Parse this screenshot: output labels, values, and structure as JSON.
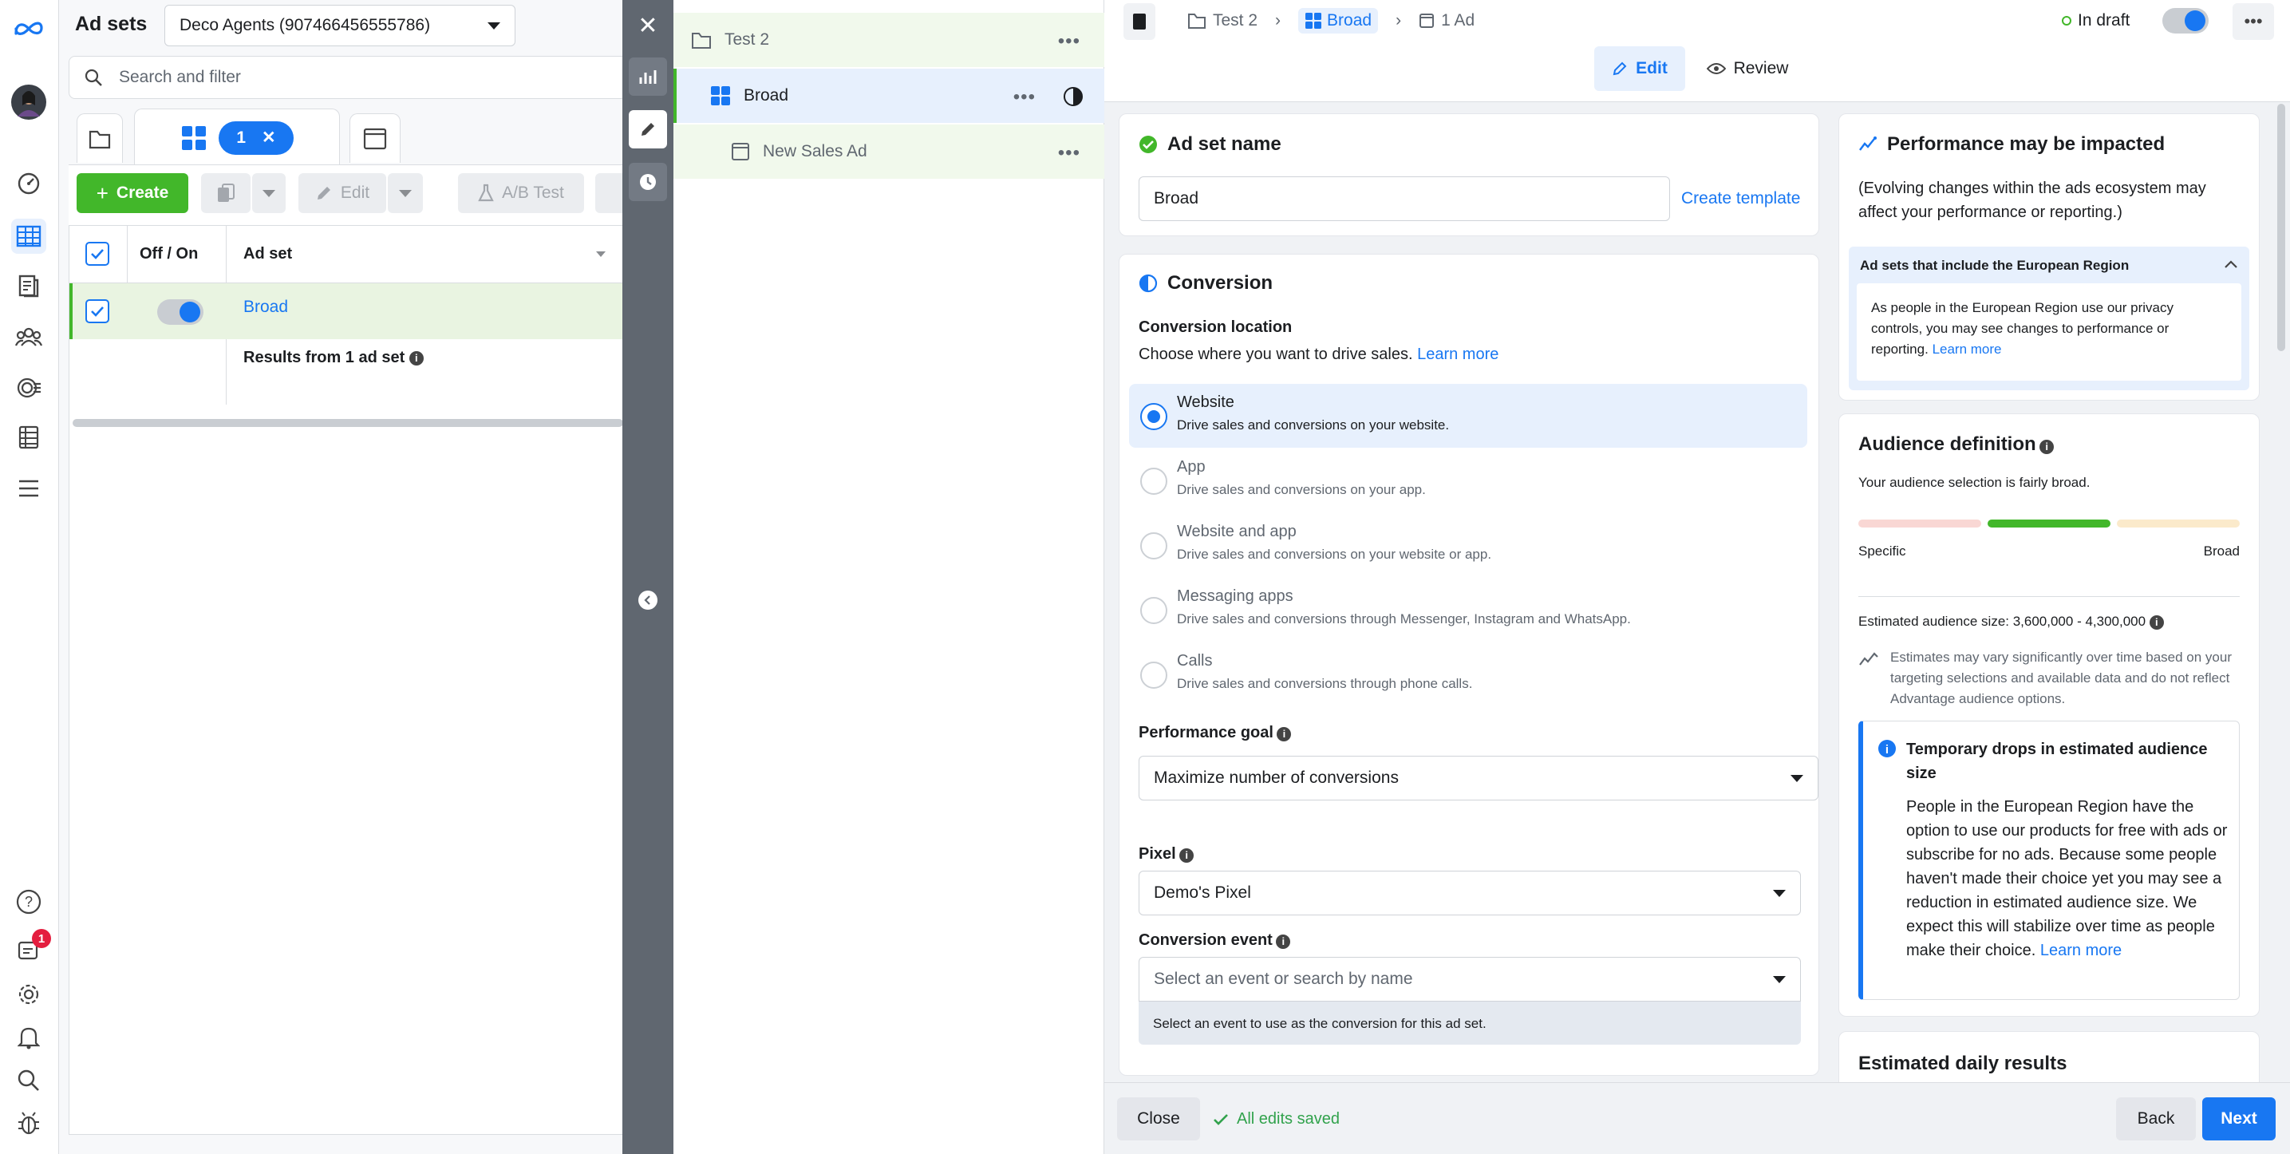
{
  "left_panel": {
    "title": "Ad sets",
    "account": "Deco Agents (907466456555786)",
    "search_placeholder": "Search and filter",
    "selection_count": "1",
    "toolbar": {
      "create": "Create",
      "edit": "Edit",
      "ab_test": "A/B Test"
    },
    "table": {
      "col_toggle": "Off / On",
      "col_adset": "Ad set",
      "rows": [
        {
          "name": "Broad"
        }
      ],
      "results": "Results from 1 ad set"
    }
  },
  "notifications_badge": "1",
  "tree": {
    "campaign": "Test 2",
    "adset": "Broad",
    "ad": "New Sales Ad"
  },
  "breadcrumb": {
    "campaign": "Test 2",
    "adset": "Broad",
    "ad": "1 Ad"
  },
  "status": "In draft",
  "view_tabs": {
    "edit": "Edit",
    "review": "Review"
  },
  "adset_name_card": {
    "title": "Ad set name",
    "value": "Broad",
    "create_template": "Create template"
  },
  "conversion_card": {
    "title": "Conversion",
    "location_label": "Conversion location",
    "location_help": "Choose where you want to drive sales.",
    "learn_more": "Learn more",
    "options": [
      {
        "title": "Website",
        "desc": "Drive sales and conversions on your website.",
        "selected": true
      },
      {
        "title": "App",
        "desc": "Drive sales and conversions on your app.",
        "selected": false
      },
      {
        "title": "Website and app",
        "desc": "Drive sales and conversions on your website or app.",
        "selected": false
      },
      {
        "title": "Messaging apps",
        "desc": "Drive sales and conversions through Messenger, Instagram and WhatsApp.",
        "selected": false
      },
      {
        "title": "Calls",
        "desc": "Drive sales and conversions through phone calls.",
        "selected": false
      }
    ],
    "performance_goal_label": "Performance goal",
    "performance_goal_value": "Maximize number of conversions",
    "pixel_label": "Pixel",
    "pixel_value": "Demo's Pixel",
    "conversion_event_label": "Conversion event",
    "conversion_event_placeholder": "Select an event or search by name",
    "conversion_event_hint": "Select an event to use as the conversion for this ad set."
  },
  "performance_card": {
    "title": "Performance may be impacted",
    "body": "(Evolving changes within the ads ecosystem may affect your performance or reporting.)",
    "section_title": "Ad sets that include the European Region",
    "section_body": "As people in the European Region use our privacy controls, you may see changes to performance or reporting.",
    "learn_more": "Learn more"
  },
  "audience_card": {
    "title": "Audience definition",
    "summary": "Your audience selection is fairly broad.",
    "left_label": "Specific",
    "right_label": "Broad",
    "estimated_size": "Estimated audience size: 3,600,000 - 4,300,000",
    "estimate_note": "Estimates may vary significantly over time based on your targeting selections and available data and do not reflect Advantage audience options.",
    "notice_title": "Temporary drops in estimated audience size",
    "notice_body": "People in the European Region have the option to use our products for free with ads or subscribe for no ads. Because some people haven't made their choice yet you may see a reduction in estimated audience size. We expect this will stabilize over time as people make their choice.",
    "notice_link": "Learn more"
  },
  "daily_results_title": "Estimated daily results",
  "footer": {
    "close": "Close",
    "saved": "All edits saved",
    "back": "Back",
    "next": "Next"
  },
  "colors": {
    "accent": "#1877f2",
    "create_green": "#42b72a",
    "selected_row": "#e9f4e1",
    "gauge_active": "#42b72a"
  }
}
